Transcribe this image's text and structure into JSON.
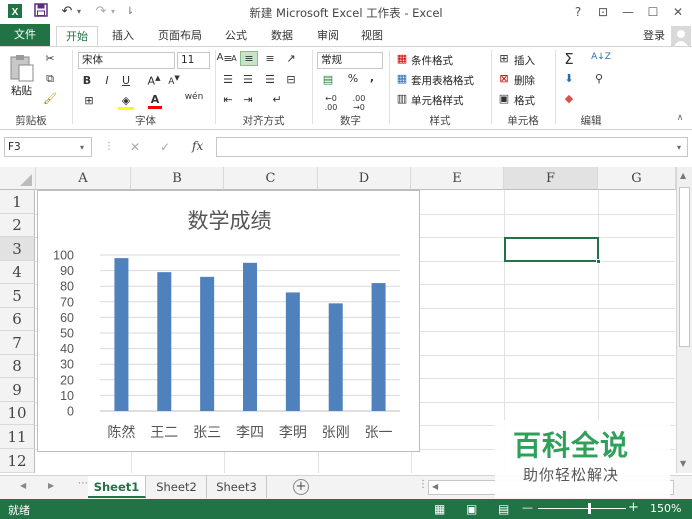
{
  "app": {
    "title": "新建 Microsoft Excel 工作表 - Excel",
    "window_help": "?",
    "window_restore": "⊡",
    "window_minimize": "—",
    "window_maximize": "☐",
    "window_close": "✕"
  },
  "tabs": [
    "文件",
    "开始",
    "插入",
    "页面布局",
    "公式",
    "数据",
    "审阅",
    "视图"
  ],
  "login": "登录",
  "ribbon": {
    "clipboard": {
      "paste": "粘贴",
      "label": "剪贴板"
    },
    "font": {
      "name": "宋体",
      "size": "11",
      "bold": "B",
      "italic": "I",
      "underline": "U",
      "grow": "A",
      "shrink": "A",
      "font_color": "A",
      "wen": "wén",
      "label": "字体"
    },
    "alignment": {
      "label": "对齐方式"
    },
    "number": {
      "format": "常规",
      "percent": "%",
      "comma": ",",
      "inc": "←0 .00",
      "dec": ".00 →0",
      "label": "数字"
    },
    "styles": {
      "conditional": "条件格式",
      "table": "套用表格格式",
      "cell": "单元格样式",
      "label": "样式"
    },
    "cells": {
      "insert": "插入",
      "delete": "删除",
      "format": "格式",
      "label": "单元格"
    },
    "editing": {
      "sum": "Σ",
      "sort": "A↓Z",
      "label": "编辑"
    }
  },
  "formula_bar": {
    "name_box": "F3",
    "cancel": "✕",
    "enter": "✓",
    "fx": "fx",
    "value": ""
  },
  "grid": {
    "columns": [
      "A",
      "B",
      "C",
      "D",
      "E",
      "F",
      "G"
    ],
    "rows": [
      "1",
      "2",
      "3",
      "4",
      "5",
      "6",
      "7",
      "8",
      "9",
      "10",
      "11",
      "12"
    ]
  },
  "chart_data": {
    "type": "bar",
    "title": "数学成绩",
    "categories": [
      "陈然",
      "王二",
      "张三",
      "李四",
      "李明",
      "张刚",
      "张一"
    ],
    "values": [
      98,
      89,
      86,
      95,
      76,
      69,
      82
    ],
    "ylim": [
      0,
      100
    ],
    "yticks": [
      0,
      10,
      20,
      30,
      40,
      50,
      60,
      70,
      80,
      90,
      100
    ],
    "xlabel": "",
    "ylabel": "",
    "grid": true,
    "legend": "none",
    "bar_color": "#4f81bd"
  },
  "sheets": [
    "Sheet1",
    "Sheet2",
    "Sheet3"
  ],
  "active_sheet": "Sheet1",
  "add_sheet": "+",
  "status": {
    "ready": "就绪",
    "zoom": "150%",
    "zoom_minus": "—",
    "zoom_plus": "+"
  },
  "watermark": {
    "main": "百科全说",
    "sub": "助你轻松解决"
  },
  "colors": {
    "excel_green": "#217346",
    "accent": "#4f81bd"
  }
}
